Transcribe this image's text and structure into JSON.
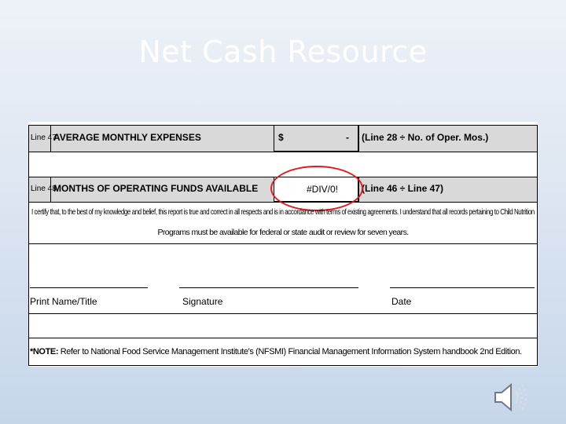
{
  "slide": {
    "title": "Net Cash Resource"
  },
  "form": {
    "line47": {
      "label": "Line 47",
      "description": "AVERAGE MONTHLY EXPENSES",
      "currency": "$",
      "value": "-",
      "formula": "(Line 28 ÷ No. of Oper. Mos.)"
    },
    "line48": {
      "label": "Line 48",
      "description": "MONTHS OF OPERATING FUNDS AVAILABLE",
      "value": "#DIV/0!",
      "formula": "(Line 46 ÷ Line 47)"
    },
    "certification": {
      "line1": "I certify that, to the best of my knowledge and belief, this report is true and correct in all respects and is in accordance with terms of existing agreements. I understand that all records pertaining to Child Nutrition",
      "line2": "Programs must be available for federal or state audit or review for seven years."
    },
    "signature_row": {
      "print_name_label": "Print Name/Title",
      "signature_label": "Signature",
      "date_label": "Date"
    },
    "note": {
      "prefix": "*NOTE:",
      "text": "Refer to National Food Service Management Institute's (NFSMI) Financial Management Information System handbook 2nd Edition."
    },
    "highlight_color": "#e11b1b"
  },
  "audio": {
    "icon": "speaker-icon"
  }
}
